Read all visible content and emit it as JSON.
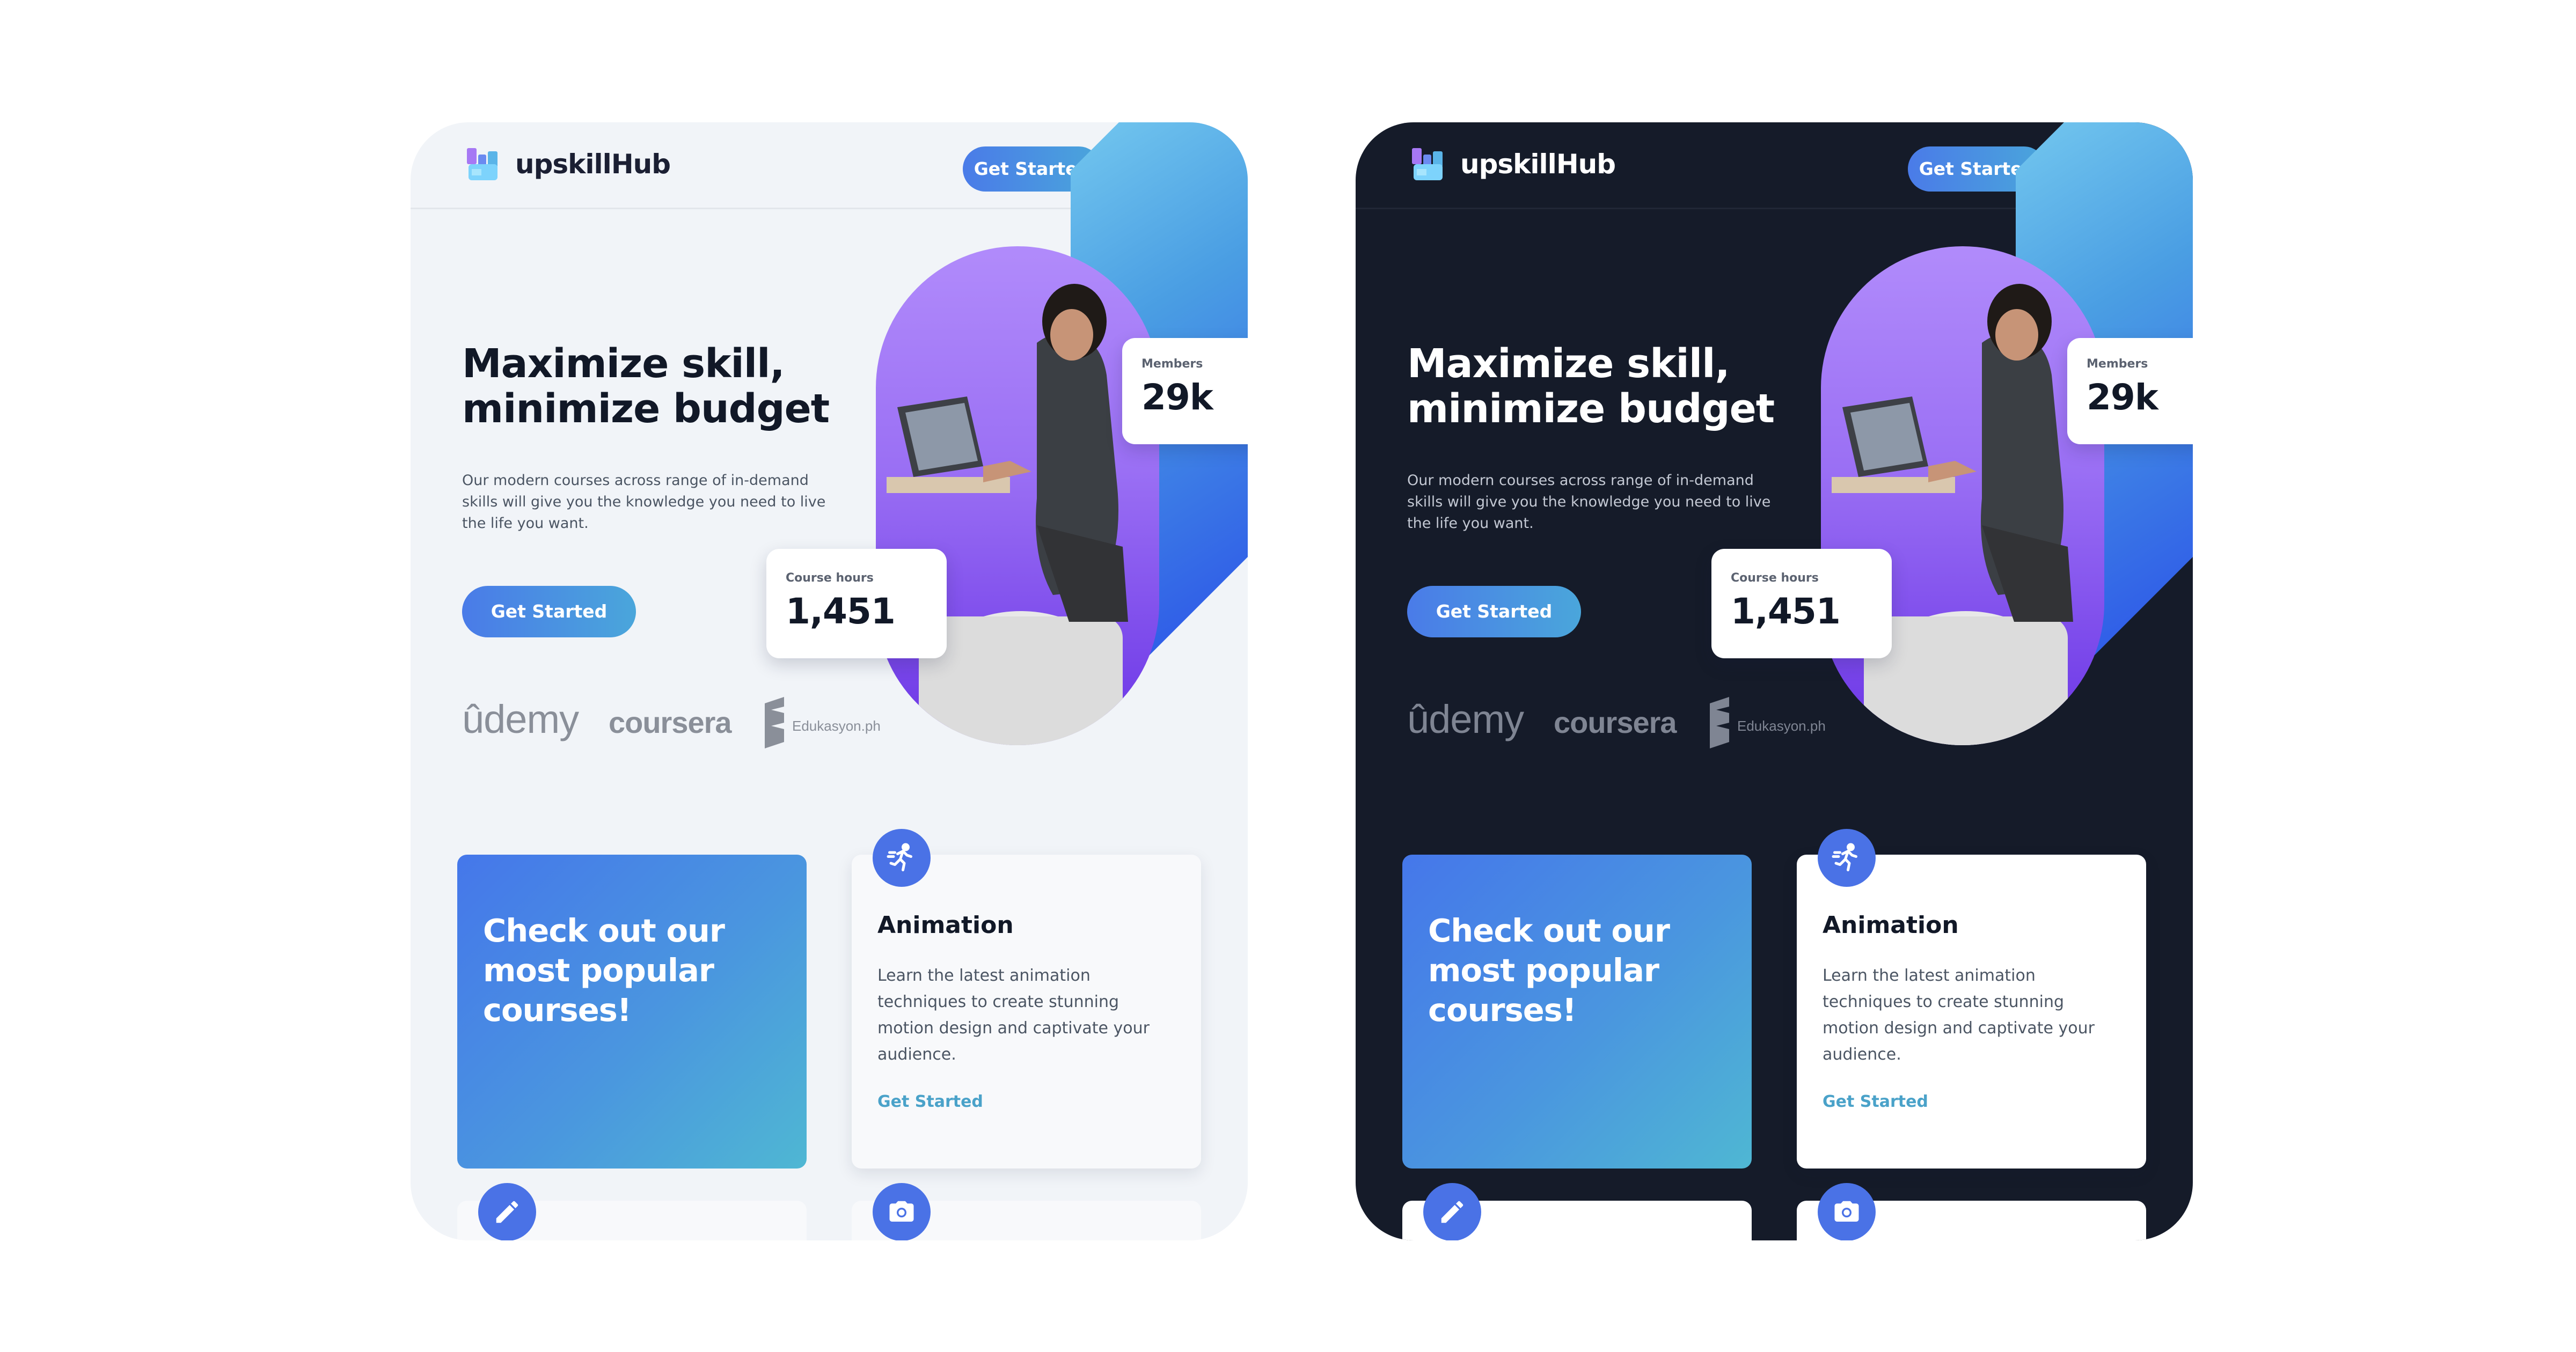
{
  "colors": {
    "accent_blue": "#4a7be8",
    "accent_cyan": "#4aa6db",
    "light_background": "#f1f4f8",
    "dark_background": "#151b29",
    "photo_purple": "#8b5cf6",
    "link_teal": "#4aa2c9"
  },
  "light": {
    "brand": "upskillHub",
    "nav_button": "Get Started",
    "hero_title_line1": "Maximize skill,",
    "hero_title_line2": "minimize budget",
    "hero_desc": "Our modern courses across range of in-demand skills will give you the knowledge you need to live the life you want.",
    "hero_button": "Get Started",
    "partners": [
      "ûdemy",
      "coursera",
      "Edukasyon.ph"
    ],
    "members_label": "Members",
    "members_value": "29k",
    "hours_label": "Course hours",
    "hours_value": "1,451",
    "promo_title": "Check out our most popular courses!",
    "course_title": "Animation",
    "course_desc": "Learn the latest animation techniques to create stunning motion design and captivate your audience.",
    "course_link": "Get Started"
  },
  "dark": {
    "brand": "upskillHub",
    "nav_button": "Get Started",
    "hero_title_line1": "Maximize skill,",
    "hero_title_line2": "minimize budget",
    "hero_desc": "Our modern courses across range of in-demand skills will give you the knowledge you need to live the life you want.",
    "hero_button": "Get Started",
    "partners": [
      "ûdemy",
      "coursera",
      "Edukasyon.ph"
    ],
    "members_label": "Members",
    "members_value": "29k",
    "hours_label": "Course hours",
    "hours_value": "1,451",
    "promo_title": "Check out our most popular courses!",
    "course_title": "Animation",
    "course_desc": "Learn the latest animation techniques to create stunning motion design and captivate your audience.",
    "course_link": "Get Started"
  },
  "icons": {
    "logo": "upskillhub-logo-icon",
    "user": "user-circle-icon",
    "menu": "hamburger-menu-icon",
    "animation": "running-figure-icon",
    "pencil": "pencil-icon",
    "camera": "camera-icon",
    "partner_edu": "edukasyon-logo-icon"
  }
}
